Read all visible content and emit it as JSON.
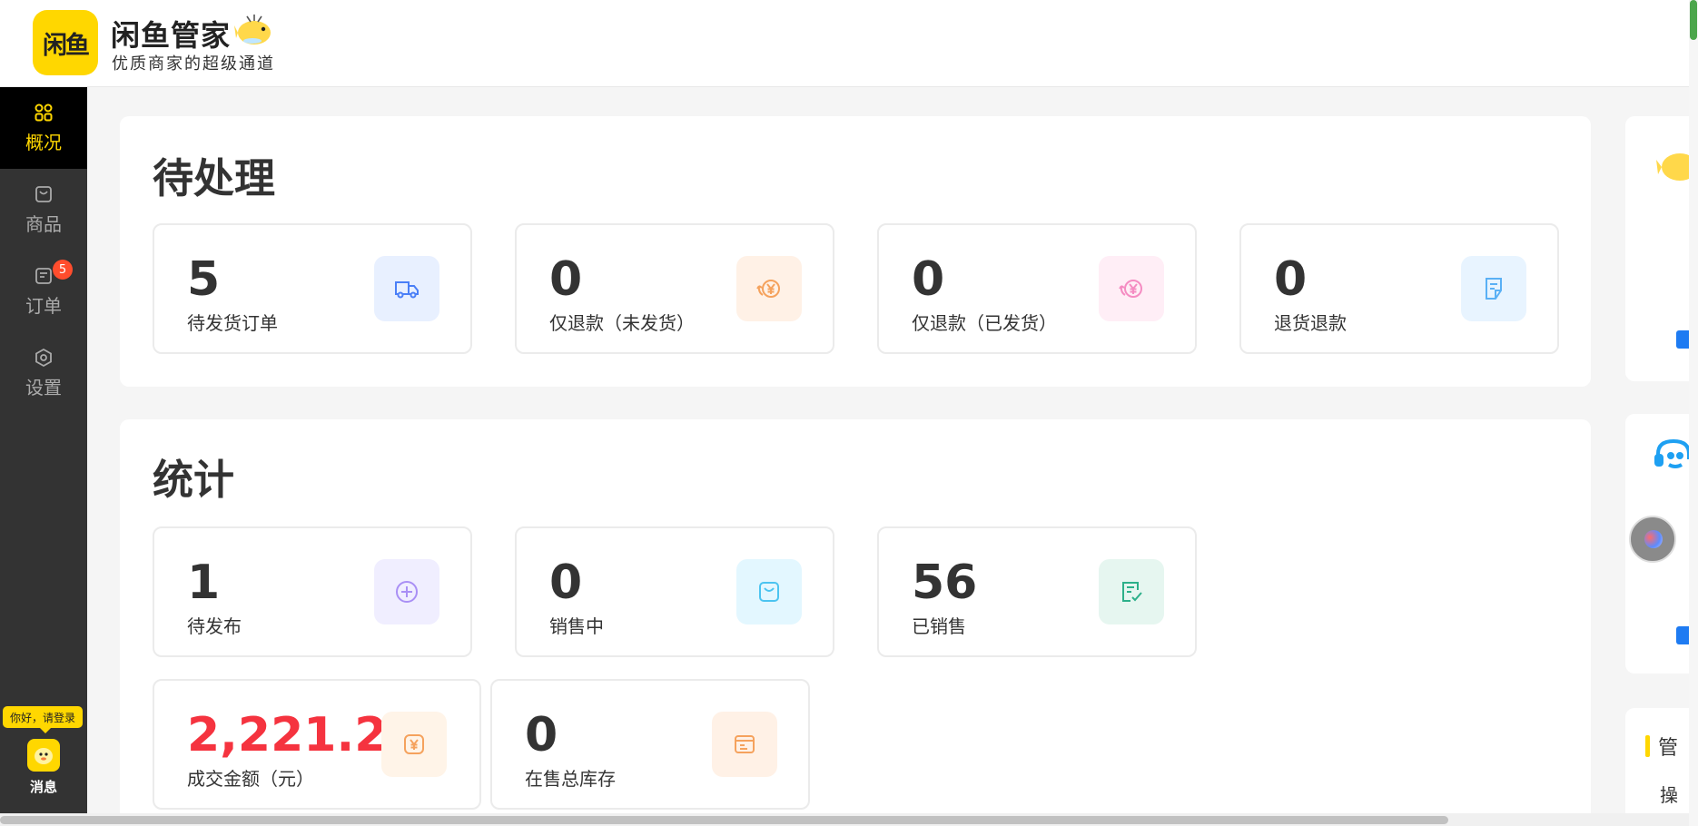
{
  "header": {
    "logo_text": "闲鱼",
    "title": "闲鱼管家",
    "subtitle": "优质商家的超级通道"
  },
  "sidebar": {
    "items": [
      {
        "label": "概况",
        "icon": "grid-icon",
        "active": true
      },
      {
        "label": "商品",
        "icon": "bag-icon",
        "active": false
      },
      {
        "label": "订单",
        "icon": "order-icon",
        "active": false,
        "badge": "5"
      },
      {
        "label": "设置",
        "icon": "gear-icon",
        "active": false
      }
    ],
    "login_tip": "你好，请登录",
    "message_label": "消息"
  },
  "pending": {
    "title": "待处理",
    "cards": [
      {
        "value": "5",
        "label": "待发货订单",
        "icon": "truck-icon",
        "icon_bg": "#e8f0ff",
        "icon_color": "#4a7ff7"
      },
      {
        "value": "0",
        "label": "仅退款（未发货）",
        "icon": "refund-icon",
        "icon_bg": "#fff1e6",
        "icon_color": "#f5a25d"
      },
      {
        "value": "0",
        "label": "仅退款（已发货）",
        "icon": "refund-icon",
        "icon_bg": "#ffeef6",
        "icon_color": "#f58cc2"
      },
      {
        "value": "0",
        "label": "退货退款",
        "icon": "return-doc-icon",
        "icon_bg": "#e8f4ff",
        "icon_color": "#5ab0f5"
      }
    ]
  },
  "stats": {
    "title": "统计",
    "cards": [
      {
        "value": "1",
        "label": "待发布",
        "icon": "plus-circle-icon",
        "icon_bg": "#f0eeff",
        "icon_color": "#a98ff5"
      },
      {
        "value": "0",
        "label": "销售中",
        "icon": "bag-icon",
        "icon_bg": "#e3f7ff",
        "icon_color": "#4cc4f0"
      },
      {
        "value": "56",
        "label": "已销售",
        "icon": "check-doc-icon",
        "icon_bg": "#e6f6f0",
        "icon_color": "#2db08a"
      },
      {
        "value": "2,221.20",
        "label": "成交金额（元）",
        "icon": "yuan-icon",
        "icon_bg": "#fff4e8",
        "icon_color": "#f5a25d"
      },
      {
        "value": "0",
        "label": "在售总库存",
        "icon": "inventory-icon",
        "icon_bg": "#fff1e6",
        "icon_color": "#f5a25d"
      }
    ]
  },
  "right": {
    "manage_label": "管",
    "op_label": "操"
  }
}
